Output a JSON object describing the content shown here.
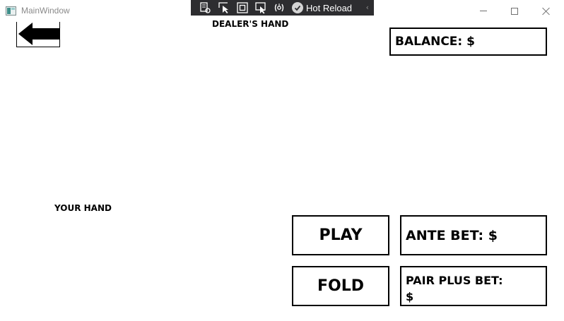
{
  "window": {
    "title": "MainWindow",
    "icons": {
      "app": "app-window-icon",
      "minimize": "minimize-icon",
      "maximize": "maximize-icon",
      "close": "close-icon"
    }
  },
  "debug_toolbar": {
    "hot_reload_label": "Hot Reload",
    "icons": [
      "live-visual-tree-icon",
      "select-element-icon",
      "display-layout-adorners-icon",
      "track-focus-icon",
      "binding-failures-icon",
      "hot-reload-check-icon",
      "collapse-chevron-icon"
    ],
    "background": "#2d2d30"
  },
  "game": {
    "back_icon": "left-arrow-icon",
    "dealer_hand_label": "DEALER'S HAND",
    "your_hand_label": "YOUR HAND",
    "balance_label": "BALANCE: $",
    "play_label": "PLAY",
    "fold_label": "FOLD",
    "ante_bet_label": "ANTE BET: $",
    "pair_plus_label": "PAIR PLUS BET:",
    "pair_plus_currency": "$"
  },
  "colors": {
    "background": "#ffffff",
    "text": "#000000",
    "border": "#000000",
    "hot_reload_ok": "#d4d4d4"
  }
}
